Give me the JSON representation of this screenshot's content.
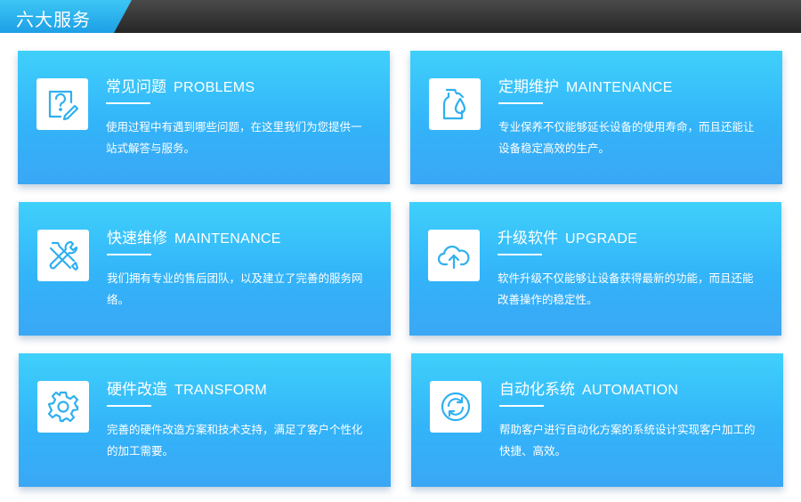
{
  "header": {
    "title": "六大服务"
  },
  "cards": [
    {
      "title_cn": "常见问题",
      "title_en": "PROBLEMS",
      "desc": "使用过程中有遇到哪些问题，在这里我们为您提供一站式解答与服务。",
      "icon": "question-edit-icon"
    },
    {
      "title_cn": "定期维护",
      "title_en": "MAINTENANCE",
      "desc": "专业保养不仅能够延长设备的使用寿命，而且还能让设备稳定高效的生产。",
      "icon": "oil-bottle-icon"
    },
    {
      "title_cn": "快速维修",
      "title_en": "MAINTENANCE",
      "desc": "我们拥有专业的售后团队，以及建立了完善的服务网络。",
      "icon": "wrench-screwdriver-icon"
    },
    {
      "title_cn": "升级软件",
      "title_en": "UPGRADE",
      "desc": "软件升级不仅能够让设备获得最新的功能，而且还能改善操作的稳定性。",
      "icon": "cloud-upload-icon"
    },
    {
      "title_cn": "硬件改造",
      "title_en": "TRANSFORM",
      "desc": "完善的硬件改造方案和技术支持，满足了客户个性化的加工需要。",
      "icon": "gear-icon"
    },
    {
      "title_cn": "自动化系统",
      "title_en": "AUTOMATION",
      "desc": "帮助客户进行自动化方案的系统设计实现客户加工的快捷、高效。",
      "icon": "refresh-cycle-icon"
    }
  ],
  "colors": {
    "icon_blue": "#2fb0f0",
    "header_dark": "#2f2f2f",
    "tab_blue": "#2aaaea"
  }
}
